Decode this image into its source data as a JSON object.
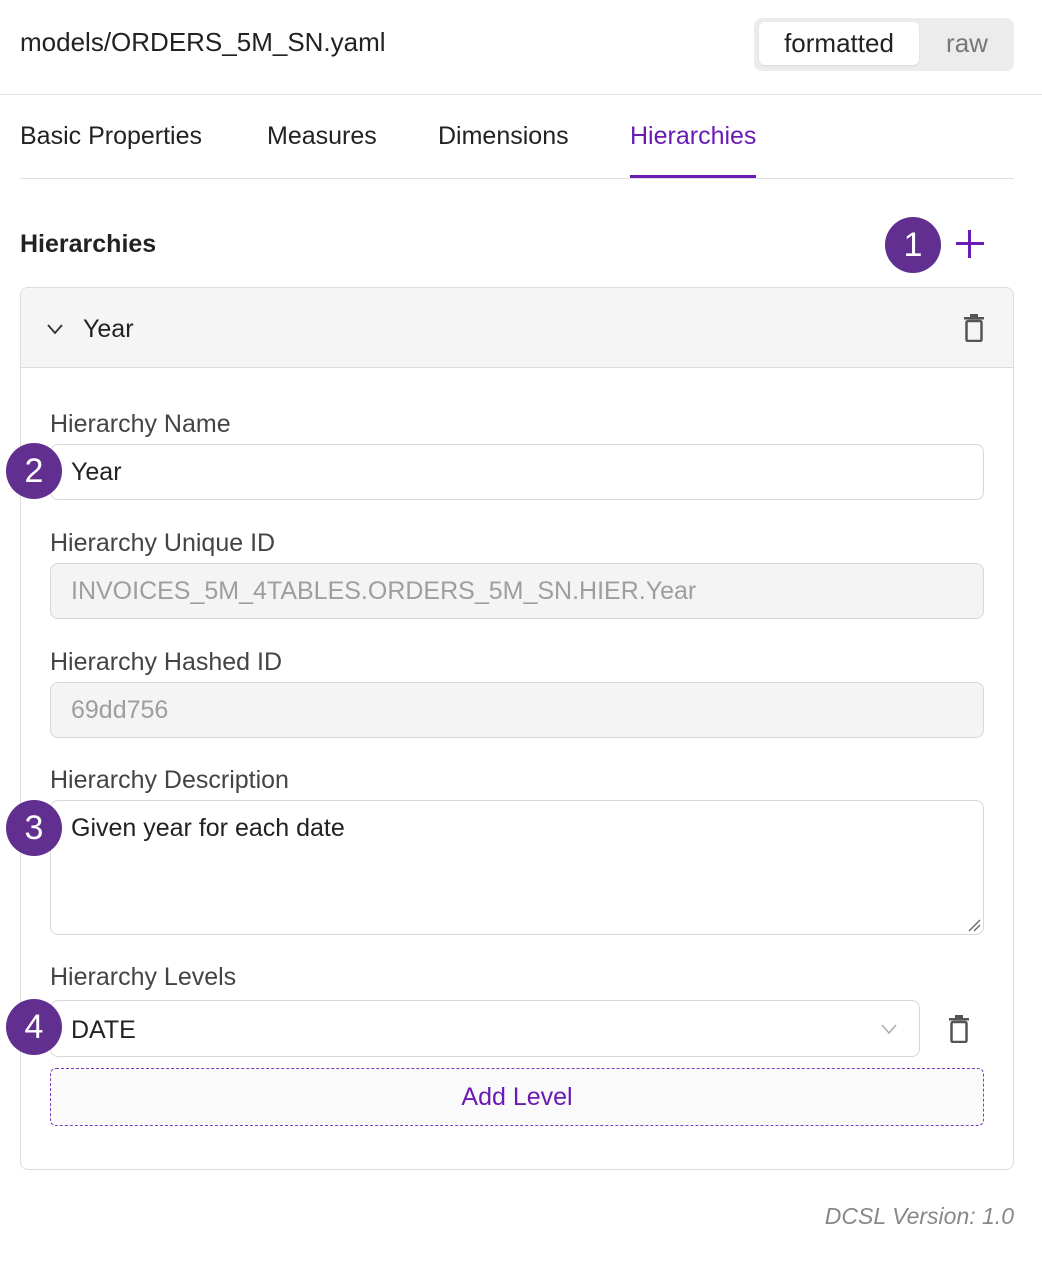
{
  "header": {
    "file_title": "models/ORDERS_5M_SN.yaml",
    "view_toggle": {
      "formatted_label": "formatted",
      "raw_label": "raw",
      "selected": "formatted"
    }
  },
  "tabs": [
    {
      "label": "Basic Properties",
      "active": false
    },
    {
      "label": "Measures",
      "active": false
    },
    {
      "label": "Dimensions",
      "active": false
    },
    {
      "label": "Hierarchies",
      "active": true
    }
  ],
  "section": {
    "title": "Hierarchies",
    "add_icon": "plus-icon"
  },
  "badges": [
    "1",
    "2",
    "3",
    "4"
  ],
  "hierarchy": {
    "title": "Year",
    "expanded": true,
    "name_label": "Hierarchy Name",
    "name_value": "Year",
    "unique_id_label": "Hierarchy Unique ID",
    "unique_id_value": "INVOICES_5M_4TABLES.ORDERS_5M_SN.HIER.Year",
    "hashed_id_label": "Hierarchy Hashed ID",
    "hashed_id_value": "69dd756",
    "description_label": "Hierarchy Description",
    "description_value": "Given year for each date",
    "levels_label": "Hierarchy Levels",
    "levels": [
      {
        "value": "DATE"
      }
    ],
    "add_level_label": "Add Level"
  },
  "footer": {
    "version": "DCSL Version: 1.0"
  },
  "colors": {
    "accent": "#6a1bb4",
    "badge": "#612f8f",
    "border": "#dcdcdc"
  }
}
